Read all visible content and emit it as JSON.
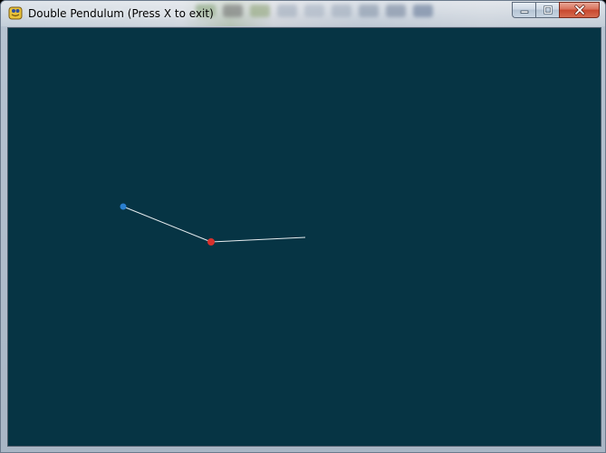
{
  "window": {
    "title": "Double Pendulum (Press X to exit)",
    "app_icon": "pygame-snake-icon",
    "buttons": {
      "minimize_icon": "minimize-icon",
      "maximize_icon": "maximize-icon",
      "close_icon": "close-icon"
    }
  },
  "colors": {
    "canvas_background": "#063444",
    "rod": "#e6ecef",
    "pivot": "#2a7fcf",
    "bob1": "#d8302c",
    "close_button": "#c7472e"
  }
}
